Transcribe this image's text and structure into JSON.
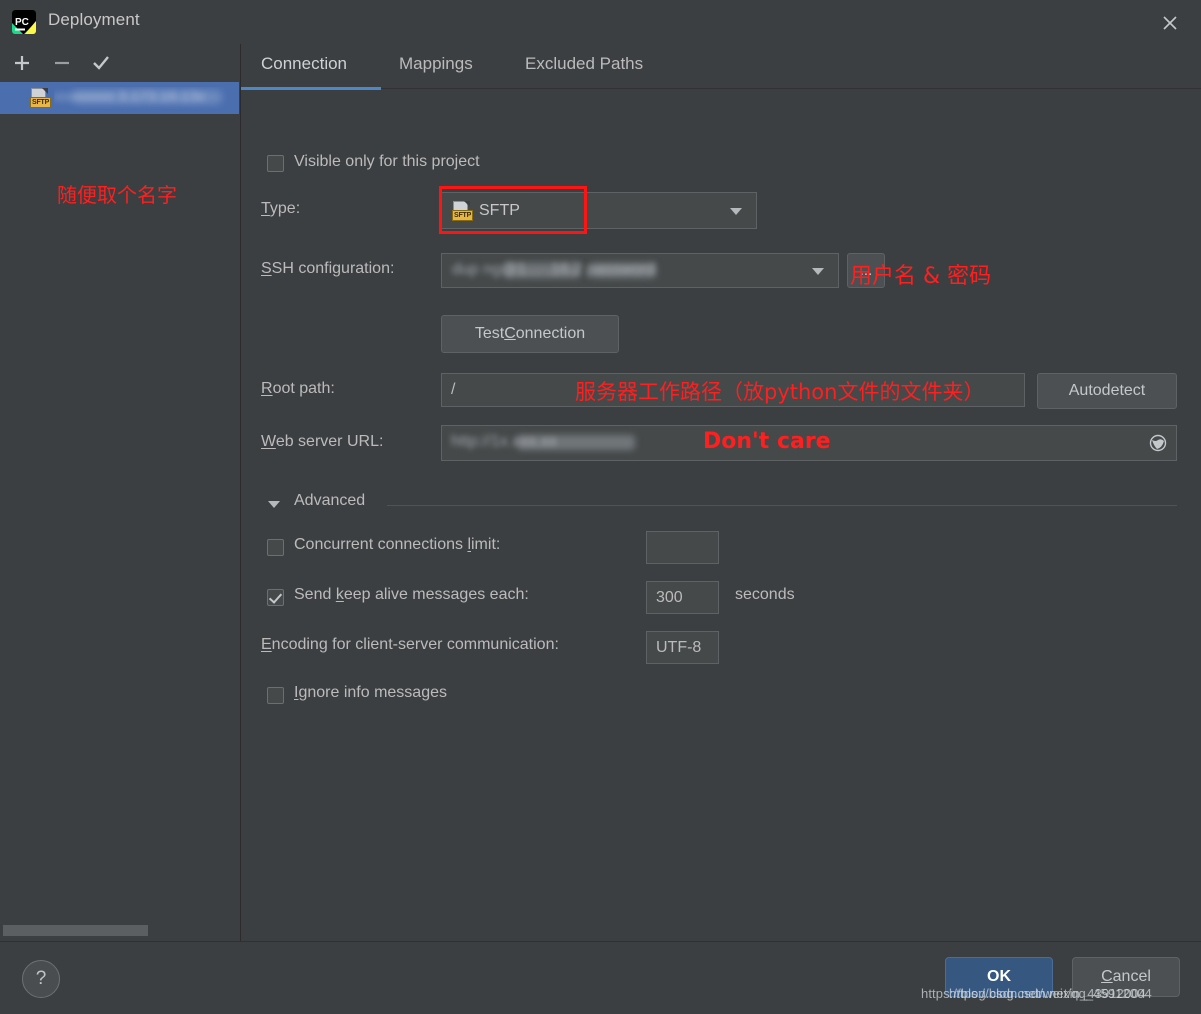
{
  "window": {
    "title": "Deployment",
    "app_icon": "pycharm-logo-icon",
    "close_icon": "close-icon"
  },
  "left_panel": {
    "toolbar": [
      {
        "name": "add",
        "icon": "plus-icon",
        "label": "+"
      },
      {
        "name": "remove",
        "icon": "minus-icon",
        "label": "−"
      },
      {
        "name": "use-as-default",
        "icon": "check-icon",
        "label": "✓"
      }
    ],
    "items": [
      {
        "type_badge": "SFTP",
        "label_masked": "xxxxxxxx 3.173.16.13x",
        "selected": true
      }
    ],
    "annotation": "随便取个名字",
    "scrollbar": "horizontal-scrollbar"
  },
  "tabs": [
    {
      "label": "Connection",
      "active": true
    },
    {
      "label": "Mappings",
      "active": false
    },
    {
      "label": "Excluded Paths",
      "active": false
    }
  ],
  "form": {
    "visible_only": {
      "label": "Visible only for this project",
      "checked": false
    },
    "type": {
      "label": "Type:",
      "mnemonic": "T",
      "value": "SFTP",
      "badge": "SFTP",
      "highlighted": true
    },
    "ssh_configuration": {
      "label": "SSH configuration:",
      "mnemonic": "S",
      "value_masked": "dup ng@1… .16.2 password",
      "value_suffix": "password",
      "browse_button": "...",
      "annotation": "用户名 & 密码"
    },
    "test_connection": {
      "label": "Test Connection",
      "mnemonic": "C"
    },
    "root_path": {
      "label": "Root path:",
      "mnemonic": "R",
      "value": "/",
      "annotation": "服务器工作路径（放python文件的文件夹）",
      "autodetect_label": "Autodetect"
    },
    "web_server_url": {
      "label": "Web server URL:",
      "mnemonic": "W",
      "value_masked": "http://1x.xxx.xx",
      "annotation": "Don't care",
      "open_icon": "globe-icon"
    },
    "advanced": {
      "label": "Advanced",
      "expanded": true,
      "collapse_icon": "triangle-down-icon"
    },
    "concurrent_connections": {
      "label": "Concurrent connections limit:",
      "mnemonic": "l",
      "checked": false,
      "value": ""
    },
    "keep_alive": {
      "label": "Send keep alive messages each:",
      "mnemonic": "k",
      "checked": true,
      "value": "300",
      "unit": "seconds"
    },
    "encoding": {
      "label": "Encoding for client-server communication:",
      "mnemonic": "E",
      "value": "UTF-8"
    },
    "ignore_info": {
      "label": "Ignore info messages",
      "mnemonic": "I",
      "checked": false
    }
  },
  "footer": {
    "help_label": "?",
    "ok_label": "OK",
    "cancel_label": "Cancel",
    "watermark_1": "https://blog.csdn.net/weixin_43912004",
    "watermark_2": "https://blog.csdn.net/qq_45912004"
  },
  "colors": {
    "background": "#3c3f41",
    "selection": "#4b6eaf",
    "accent": "#4a88c7",
    "ok_button": "#365880",
    "annotation_red": "#ff1f1f",
    "highlight_box": "#ff1414",
    "badge_yellow": "#e8b548"
  }
}
